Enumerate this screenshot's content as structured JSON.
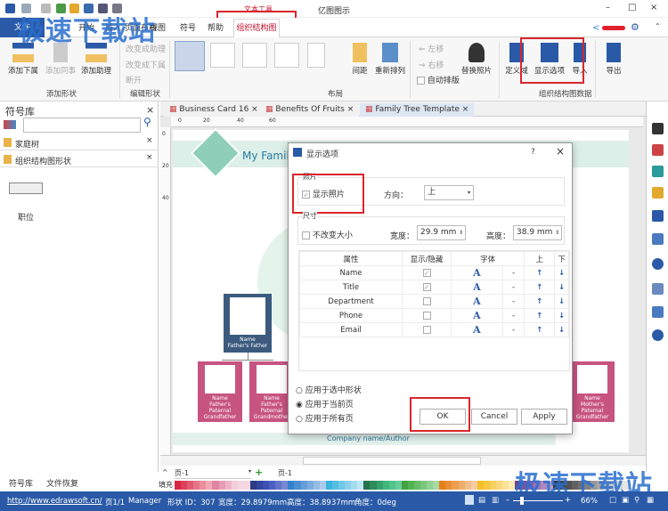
{
  "app": {
    "title": "亿图图示",
    "contextual_label": "文本工具"
  },
  "ribbon_tabs": [
    "文件",
    "开始",
    "插入",
    "页面布局",
    "视图",
    "符号",
    "帮助",
    "组织结构图"
  ],
  "ribbon": {
    "add_shape": {
      "buttons": [
        "添加下属",
        "添加同事",
        "添加助理"
      ],
      "label": "添加形状"
    },
    "edit_shape": {
      "buttons": [
        "改变成助理",
        "改变成下属",
        "断开"
      ],
      "label": "编辑形状"
    },
    "layout": {
      "buttons": [
        "间距",
        "重新排列",
        "左移",
        "右移",
        "自动排版",
        "替换照片"
      ],
      "label": "布局"
    },
    "org_data": {
      "buttons": [
        "定义域",
        "显示选项",
        "导入",
        "导出"
      ],
      "label": "组织结构图数据"
    }
  },
  "left_panel": {
    "title": "符号库",
    "search_placeholder": "",
    "libraries": [
      "家庭树",
      "组织结构图形状"
    ],
    "shape_label": "职位",
    "bottom_tabs": [
      "符号库",
      "文件恢复"
    ]
  },
  "doc_tabs": [
    "Business Card 16",
    "Benefits Of Fruits",
    "Family Tree Template"
  ],
  "ruler": {
    "h": [
      "0",
      "20",
      "40",
      "60"
    ],
    "v": [
      "0",
      "20",
      "40"
    ]
  },
  "canvas": {
    "title": "My Famil",
    "footer": "Company name/Author",
    "father": {
      "name": "Name",
      "title": "Father's Father"
    },
    "cards": [
      {
        "name": "Name",
        "title": "Father's Paternal Grandfather"
      },
      {
        "name": "Name",
        "title": "Father's Paternal Grandmother"
      },
      {
        "name": "Name",
        "title": "Mother's Paternal Grandfather"
      }
    ]
  },
  "dialog": {
    "title": "显示选项",
    "help": "?",
    "close": "×",
    "photo_group": "照片",
    "show_photo": "显示照片",
    "show_photo_checked": true,
    "direction_label": "方向：",
    "direction_value": "上",
    "size_group": "尺寸",
    "keep_size": "不改变大小",
    "keep_size_checked": false,
    "width_label": "宽度：",
    "width_value": "29.9 mm",
    "height_label": "高度：",
    "height_value": "38.9 mm",
    "table_headers": [
      "属性",
      "显示/隐藏",
      "字体",
      "上",
      "下"
    ],
    "rows": [
      {
        "name": "Name",
        "shown": true
      },
      {
        "name": "Title",
        "shown": true
      },
      {
        "name": "Department",
        "shown": false
      },
      {
        "name": "Phone",
        "shown": false
      },
      {
        "name": "Email",
        "shown": false
      }
    ],
    "font_glyph": "A",
    "dash": "-",
    "up": "↑",
    "down": "↓",
    "apply_options": [
      "应用于选中形状",
      "应用于当前页",
      "应用于所有页"
    ],
    "apply_selected": 1,
    "buttons": {
      "ok": "OK",
      "cancel": "Cancel",
      "apply": "Apply"
    }
  },
  "page_bar": {
    "page_select": "页-1",
    "page_tab": "页-1",
    "fill_label": "填充"
  },
  "status": {
    "url": "http://www.edrawsoft.cn/",
    "page": "页1/1",
    "shape_name": "Manager",
    "shape_id": "形状 ID：307",
    "width": "宽度：29.8979mm",
    "height": "高度：38.8937mm",
    "angle": "角度：0deg",
    "zoom": "66%"
  },
  "watermark": "极速下载站",
  "colors": {
    "accent": "#2a5aa7",
    "highlight": "#d9262c",
    "card_pink": "#c75480",
    "card_blue": "#3b5a7e",
    "teal": "#8fcfb9"
  }
}
